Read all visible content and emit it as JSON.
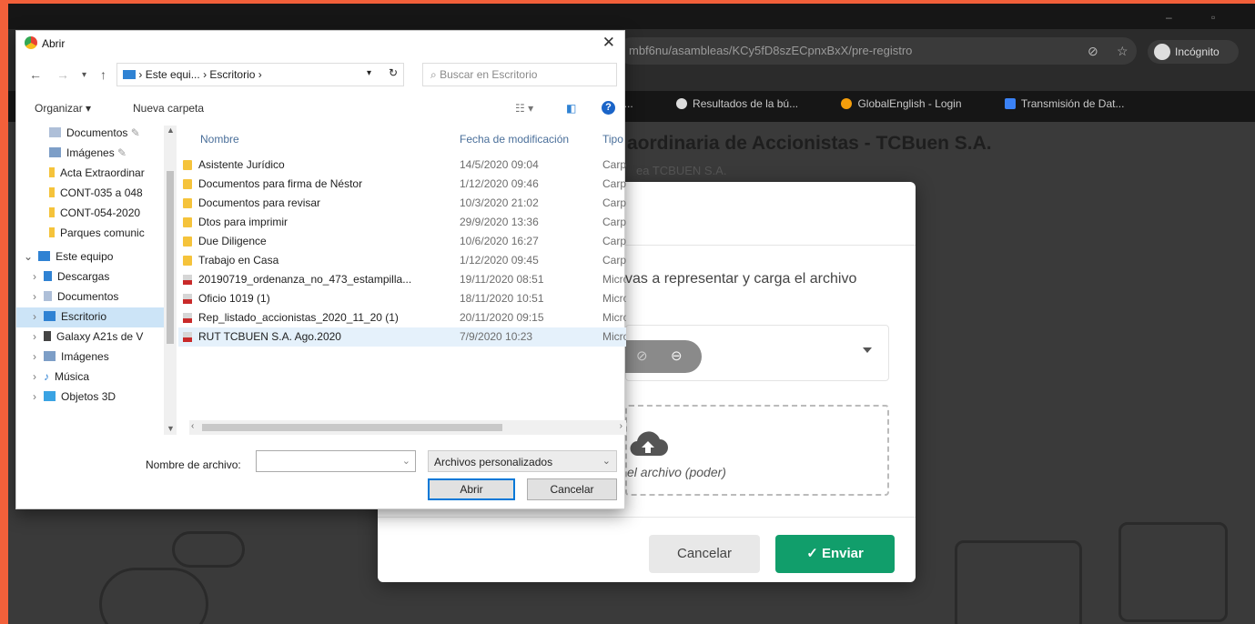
{
  "browser": {
    "url": "mbf6nu/asambleas/KCy5fD8szECpnxBxX/pre-registro",
    "incognito_label": "Incógnito",
    "bookmarks": [
      {
        "label": "ú...",
        "color": "#444444"
      },
      {
        "label": "Resultados de la bú...",
        "color": "#dddddd"
      },
      {
        "label": "GlobalEnglish - Login",
        "color": "#f59e0b"
      },
      {
        "label": "Transmisión de Dat...",
        "color": "#3b82f6"
      }
    ]
  },
  "page": {
    "title": "aordinaria de Accionistas - TCBuen S.A.",
    "subtitle": "ea TCBUEN S.A."
  },
  "modal": {
    "instruction": "vas a representar y carga el archivo",
    "dropzone_text": "el archivo (poder)",
    "cancel_label": "Cancelar",
    "send_label": "Enviar",
    "send_color": "#119e6b"
  },
  "dialog": {
    "title": "Abrir",
    "breadcrumb": [
      "Este equi...",
      "Escritorio"
    ],
    "search_placeholder": "Buscar en Escritorio",
    "organize_label": "Organizar ▾",
    "new_folder_label": "Nueva carpeta",
    "nav_items": [
      {
        "label": "Documentos",
        "icon": "documents-icon",
        "pin": true
      },
      {
        "label": "Imágenes",
        "icon": "images-icon",
        "pin": true
      },
      {
        "label": "Acta Extraordinar",
        "icon": "folder-icon"
      },
      {
        "label": "CONT-035 a 048",
        "icon": "folder-icon"
      },
      {
        "label": "CONT-054-2020",
        "icon": "folder-icon"
      },
      {
        "label": "Parques comunic",
        "icon": "folder-icon"
      },
      {
        "label": "Este equipo",
        "icon": "pc-icon",
        "expanded": true
      },
      {
        "label": "Descargas",
        "icon": "downloads-icon"
      },
      {
        "label": "Documentos",
        "icon": "documents-icon"
      },
      {
        "label": "Escritorio",
        "icon": "desktop-icon",
        "selected": true
      },
      {
        "label": "Galaxy A21s de V",
        "icon": "phone-icon"
      },
      {
        "label": "Imágenes",
        "icon": "images-icon"
      },
      {
        "label": "Música",
        "icon": "music-icon"
      },
      {
        "label": "Objetos 3D",
        "icon": "objects3d-icon"
      }
    ],
    "columns": [
      "Nombre",
      "Fecha de modificación",
      "Tipo"
    ],
    "files": [
      {
        "name": "Asistente Jurídico",
        "date": "14/5/2020 09:04",
        "type": "Carpe",
        "kind": "folder"
      },
      {
        "name": "Documentos para firma de Néstor",
        "date": "1/12/2020 09:46",
        "type": "Carpe",
        "kind": "folder"
      },
      {
        "name": "Documentos para revisar",
        "date": "10/3/2020 21:02",
        "type": "Carpe",
        "kind": "folder"
      },
      {
        "name": "Dtos para imprimir",
        "date": "29/9/2020 13:36",
        "type": "Carpe",
        "kind": "folder"
      },
      {
        "name": "Due Diligence",
        "date": "10/6/2020 16:27",
        "type": "Carpe",
        "kind": "folder"
      },
      {
        "name": "Trabajo en Casa",
        "date": "1/12/2020 09:45",
        "type": "Carpe",
        "kind": "folder"
      },
      {
        "name": "20190719_ordenanza_no_473_estampilla...",
        "date": "19/11/2020 08:51",
        "type": "Micro",
        "kind": "pdf"
      },
      {
        "name": "Oficio 1019 (1)",
        "date": "18/11/2020 10:51",
        "type": "Micro",
        "kind": "pdf"
      },
      {
        "name": "Rep_listado_accionistas_2020_11_20 (1)",
        "date": "20/11/2020 09:15",
        "type": "Micro",
        "kind": "pdf"
      },
      {
        "name": "RUT TCBUEN S.A. Ago.2020",
        "date": "7/9/2020 10:23",
        "type": "Micro",
        "kind": "pdf",
        "selected": true
      }
    ],
    "filename_label": "Nombre de archivo:",
    "filename_value": "",
    "filetype_value": "Archivos personalizados",
    "open_label": "Abrir",
    "cancel_label": "Cancelar"
  }
}
